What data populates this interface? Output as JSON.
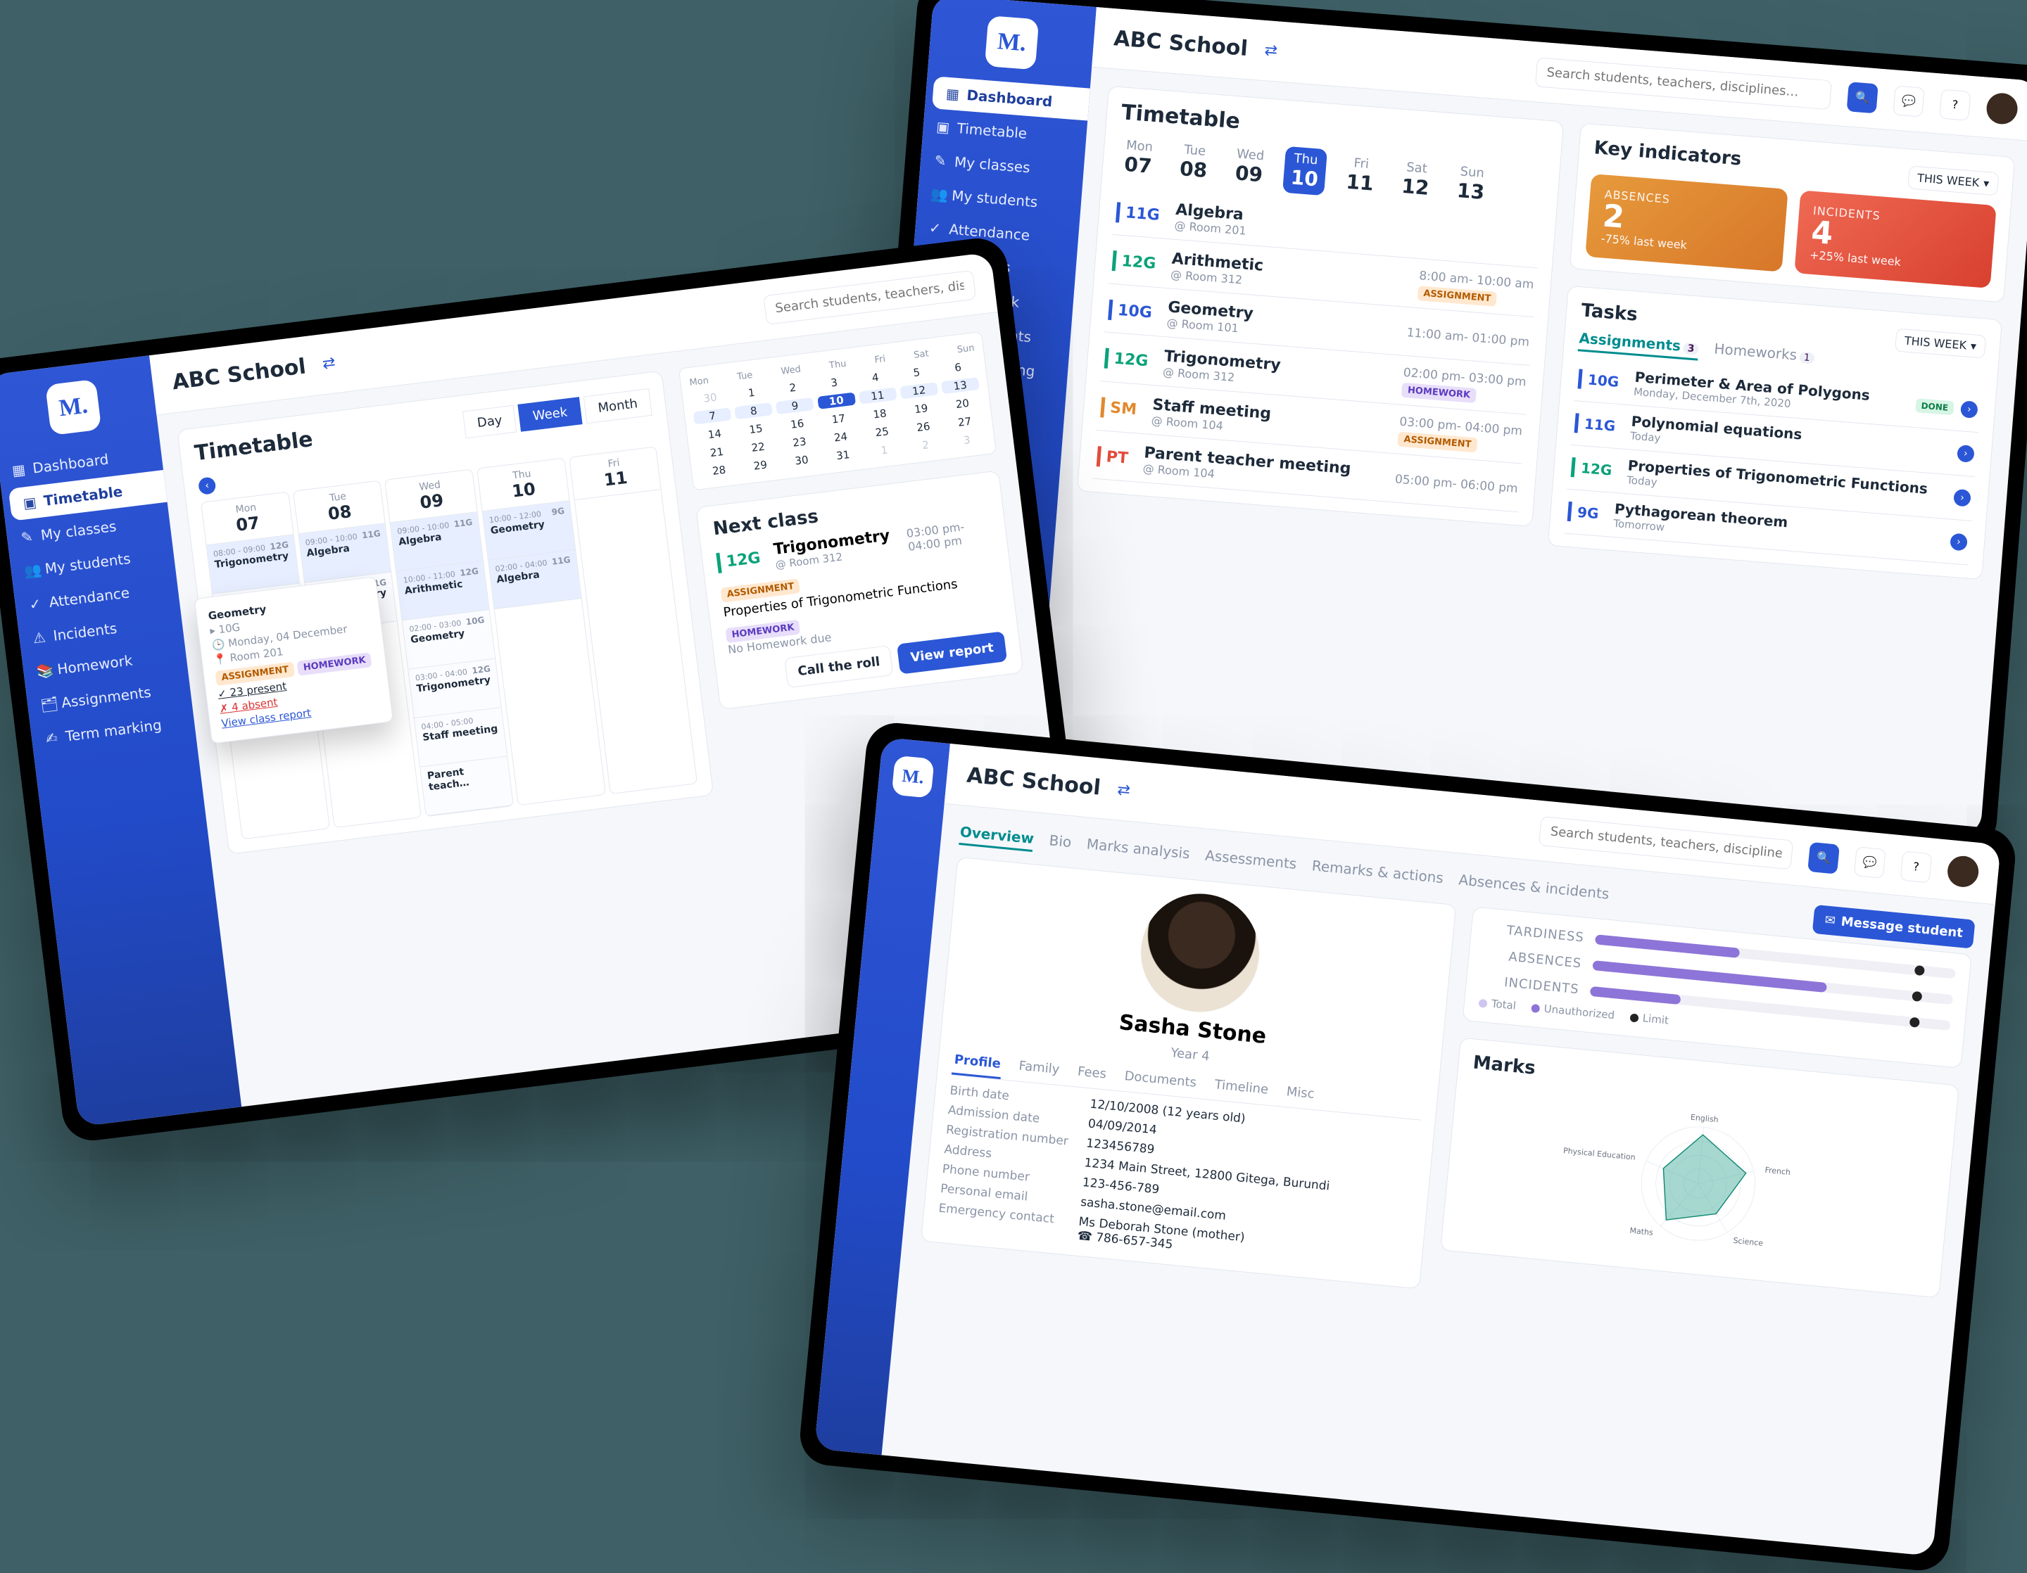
{
  "brand_glyph": "M.",
  "school_name": "ABC School",
  "search_placeholder": "Search students, teachers, disciplines…",
  "nav": {
    "dashboard": "Dashboard",
    "timetable": "Timetable",
    "myclasses": "My classes",
    "mystudents": "My students",
    "attendance": "Attendance",
    "incidents": "Incidents",
    "homework": "Homework",
    "assignments": "Assignments",
    "termmarking": "Term marking"
  },
  "timetable_title": "Timetable",
  "view_toggle": {
    "day": "Day",
    "week": "Week",
    "month": "Month"
  },
  "days": {
    "labels": [
      "Mon",
      "Tue",
      "Wed",
      "Thu",
      "Fri",
      "Sat",
      "Sun"
    ],
    "nums": [
      "07",
      "08",
      "09",
      "10",
      "11",
      "12",
      "13"
    ],
    "selected_index": 3
  },
  "schedule": [
    {
      "code": "11G",
      "color": "#2b57d6",
      "title": "Algebra",
      "room": "@ Room 201",
      "time": "",
      "tag": ""
    },
    {
      "code": "12G",
      "color": "#0aa27a",
      "title": "Arithmetic",
      "room": "@ Room 312",
      "time": "8:00 am- 10:00 am",
      "tag": "ASSIGNMENT"
    },
    {
      "code": "10G",
      "color": "#2b57d6",
      "title": "Geometry",
      "room": "@ Room 101",
      "time": "11:00 am- 01:00 pm",
      "tag": ""
    },
    {
      "code": "12G",
      "color": "#0aa27a",
      "title": "Trigonometry",
      "room": "@ Room 312",
      "time": "02:00 pm- 03:00 pm",
      "tag": "HOMEWORK"
    },
    {
      "code": "SM",
      "color": "#e08a2d",
      "title": "Staff meeting",
      "room": "@ Room 104",
      "time": "03:00 pm- 04:00 pm",
      "tag": "ASSIGNMENT"
    },
    {
      "code": "PT",
      "color": "#e24c3c",
      "title": "Parent teacher meeting",
      "room": "@ Room 104",
      "time": "05:00 pm- 06:00 pm",
      "tag": ""
    }
  ],
  "key_indicators": {
    "title": "Key indicators",
    "period": "THIS WEEK",
    "absences": {
      "label": "ABSENCES",
      "value": "2",
      "delta": "-75% last week"
    },
    "incidents": {
      "label": "INCIDENTS",
      "value": "4",
      "delta": "+25% last week"
    }
  },
  "tasks": {
    "title": "Tasks",
    "tabs": {
      "assignments": "Assignments",
      "homeworks": "Homeworks",
      "a_count": "3",
      "h_count": "1"
    },
    "period": "THIS WEEK",
    "items": [
      {
        "code": "10G",
        "color": "#2b57d6",
        "name": "Perimeter & Area of Polygons",
        "when": "Monday, December 7th, 2020",
        "done": true
      },
      {
        "code": "11G",
        "color": "#2b57d6",
        "name": "Polynomial equations",
        "when": "Today",
        "done": false
      },
      {
        "code": "12G",
        "color": "#0aa27a",
        "name": "Properties of Trigonometric Functions",
        "when": "Today",
        "done": false
      },
      {
        "code": "9G",
        "color": "#2b57d6",
        "name": "Pythagorean theorem",
        "when": "Tomorrow",
        "done": false
      }
    ]
  },
  "calendar_week": {
    "columns": [
      {
        "day": "Mon",
        "num": "07",
        "slots": [
          {
            "time": "08:00 - 09:00",
            "title": "Trigonometry",
            "code": "12G",
            "blue": true
          },
          {
            "time": "",
            "title": "Geometry",
            "code": "10G",
            "blue": false
          }
        ]
      },
      {
        "day": "Tue",
        "num": "08",
        "slots": [
          {
            "time": "09:00 - 10:00",
            "title": "Algebra",
            "code": "11G",
            "blue": true
          },
          {
            "time": "",
            "title": "Trigonometry",
            "code": "11G",
            "blue": false
          }
        ]
      },
      {
        "day": "Wed",
        "num": "09",
        "slots": [
          {
            "time": "09:00 - 10:00",
            "title": "Algebra",
            "code": "11G",
            "blue": true
          },
          {
            "time": "10:00 - 11:00",
            "title": "Arithmetic",
            "code": "12G",
            "blue": true
          },
          {
            "time": "02:00 - 03:00",
            "title": "Geometry",
            "code": "10G",
            "blue": false
          },
          {
            "time": "03:00 - 04:00",
            "title": "Trigonometry",
            "code": "12G",
            "blue": false
          },
          {
            "time": "04:00 - 05:00",
            "title": "Staff meeting",
            "code": "",
            "blue": false
          },
          {
            "time": "",
            "title": "Parent teach…",
            "code": "",
            "blue": false
          }
        ]
      },
      {
        "day": "Thu",
        "num": "10",
        "slots": [
          {
            "time": "10:00 - 12:00",
            "title": "Geometry",
            "code": "9G",
            "blue": true
          },
          {
            "time": "02:00 - 04:00",
            "title": "Algebra",
            "code": "11G",
            "blue": true
          }
        ]
      },
      {
        "day": "Fri",
        "num": "11",
        "slots": []
      }
    ]
  },
  "popover": {
    "title": "Geometry",
    "code": "10G",
    "date": "Monday, 04 December",
    "room": "Room 201",
    "tag1": "ASSIGNMENT",
    "tag2": "HOMEWORK",
    "present": "23 present",
    "absent": "4 absent",
    "link": "View class report"
  },
  "month": {
    "head": [
      "Mon",
      "Tue",
      "Wed",
      "Thu",
      "Fri",
      "Sat",
      "Sun"
    ],
    "rows": [
      [
        "30",
        "1",
        "2",
        "3",
        "4",
        "5",
        "6"
      ],
      [
        "7",
        "8",
        "9",
        "10",
        "11",
        "12",
        "13"
      ],
      [
        "14",
        "15",
        "16",
        "17",
        "18",
        "19",
        "20"
      ],
      [
        "21",
        "22",
        "23",
        "24",
        "25",
        "26",
        "27"
      ],
      [
        "28",
        "29",
        "30",
        "31",
        "1",
        "2",
        "3"
      ]
    ],
    "selected": "10",
    "range_row": 1
  },
  "next_class": {
    "title": "Next class",
    "code": "12G",
    "name": "Trigonometry",
    "room": "@ Room 312",
    "time": "03:00 pm- 04:00 pm",
    "assignment_tag": "ASSIGNMENT",
    "assignment_name": "Properties of Trigonometric Functions",
    "homework_tag": "HOMEWORK",
    "homework_name": "No Homework due",
    "btn_roll": "Call the roll",
    "btn_report": "View report"
  },
  "student": {
    "top_tabs": [
      "Overview",
      "Bio",
      "Marks analysis",
      "Assessments",
      "Remarks & actions",
      "Absences & incidents"
    ],
    "name": "Sasha Stone",
    "year": "Year 4",
    "subtabs": [
      "Profile",
      "Family",
      "Fees",
      "Documents",
      "Timeline",
      "Misc"
    ],
    "birth_k": "Birth date",
    "birth_v": "12/10/2008 (12 years old)",
    "adm_k": "Admission date",
    "adm_v": "04/09/2014",
    "reg_k": "Registration number",
    "reg_v": "123456789",
    "addr_k": "Address",
    "addr_v": "1234 Main Street, 12800 Gitega, Burundi",
    "phone_k": "Phone number",
    "phone_v": "123-456-789",
    "email_k": "Personal email",
    "email_v": "sasha.stone@email.com",
    "emg_k": "Emergency contact",
    "emg_name": "Ms Deborah Stone (mother)",
    "emg_phone": "786-657-345",
    "meters": {
      "tardiness": "TARDINESS",
      "absences": "ABSENCES",
      "incidents": "INCIDENTS"
    },
    "meter_values": {
      "tardiness": 40,
      "absences": 65,
      "incidents": 25,
      "limit": 90
    },
    "legend": {
      "total": "Total",
      "unauth": "Unauthorized",
      "limit": "Limit"
    },
    "msg_btn": "Message student",
    "marks_title": "Marks",
    "radar_labels": [
      "English",
      "French",
      "Science",
      "Maths",
      "Physical Education"
    ]
  }
}
